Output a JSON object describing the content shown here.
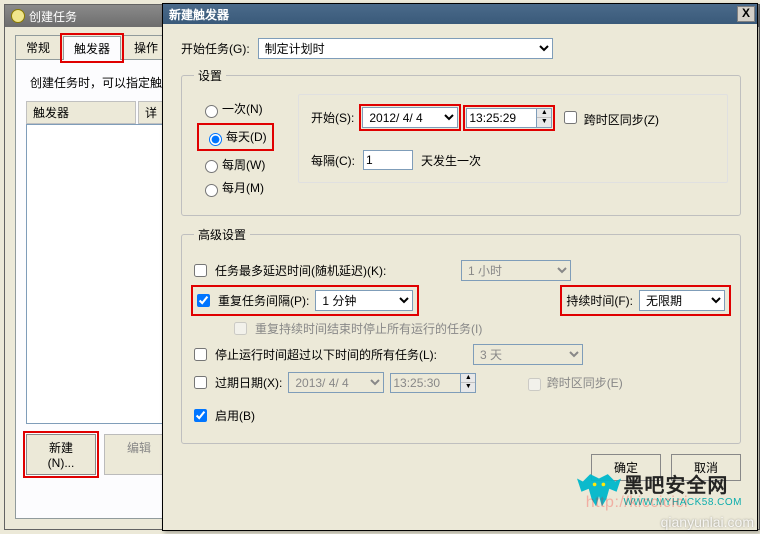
{
  "back": {
    "title": "创建任务",
    "tabs": {
      "general": "常规",
      "triggers": "触发器",
      "actions": "操作"
    },
    "desc": "创建任务时，可以指定触",
    "col_trigger": "触发器",
    "col_detail": "详",
    "btn_new": "新建(N)...",
    "btn_edit": "编辑"
  },
  "dialog": {
    "title": "新建触发器",
    "close": "X",
    "begin_label": "开始任务(G):",
    "begin_value": "制定计划时",
    "settings_legend": "设置",
    "freq": {
      "once": "一次(N)",
      "daily": "每天(D)",
      "weekly": "每周(W)",
      "monthly": "每月(M)"
    },
    "start_label": "开始(S):",
    "start_date": "2012/ 4/ 4",
    "start_time": "13:25:29",
    "sync_tz": "跨时区同步(Z)",
    "every_label": "每隔(C):",
    "every_value": "1",
    "every_suffix": "天发生一次",
    "adv_legend": "高级设置",
    "adv": {
      "delay_label": "任务最多延迟时间(随机延迟)(K):",
      "delay_value": "1 小时",
      "repeat_label": "重复任务间隔(P):",
      "repeat_value": "1 分钟",
      "duration_label": "持续时间(F):",
      "duration_value": "无限期",
      "stop_repeat": "重复持续时间结束时停止所有运行的任务(I)",
      "stop_after_label": "停止运行时间超过以下时间的所有任务(L):",
      "stop_after_value": "3 天",
      "expire_label": "过期日期(X):",
      "expire_date": "2013/ 4/ 4",
      "expire_time": "13:25:30",
      "expire_tz": "跨时区同步(E)",
      "enabled": "启用(B)"
    },
    "ok": "确定",
    "cancel": "取消"
  },
  "logo": {
    "big": "黑吧安全网",
    "small": "WWW.MYHACK58.COM"
  },
  "watermark": "qianyunlai.com",
  "watermark2": "http://kiccicici"
}
